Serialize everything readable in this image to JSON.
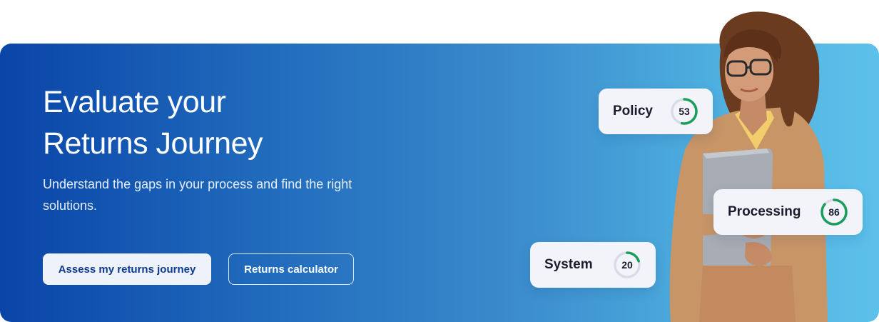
{
  "hero": {
    "title_line1": "Evaluate your",
    "title_line2": "Returns Journey",
    "subtitle": "Understand the gaps in your process and find the right solutions.",
    "primary_button": "Assess my returns journey",
    "secondary_button": "Returns calculator"
  },
  "scores": [
    {
      "label": "Policy",
      "value": "53",
      "percent": 53
    },
    {
      "label": "Processing",
      "value": "86",
      "percent": 86
    },
    {
      "label": "System",
      "value": "20",
      "percent": 20
    }
  ],
  "colors": {
    "banner_start": "#0a45a8",
    "banner_end": "#5cc1ea",
    "ring_progress": "#1a9e5c",
    "ring_track": "#d9dbe6",
    "primary_button_text": "#0c3a91"
  }
}
